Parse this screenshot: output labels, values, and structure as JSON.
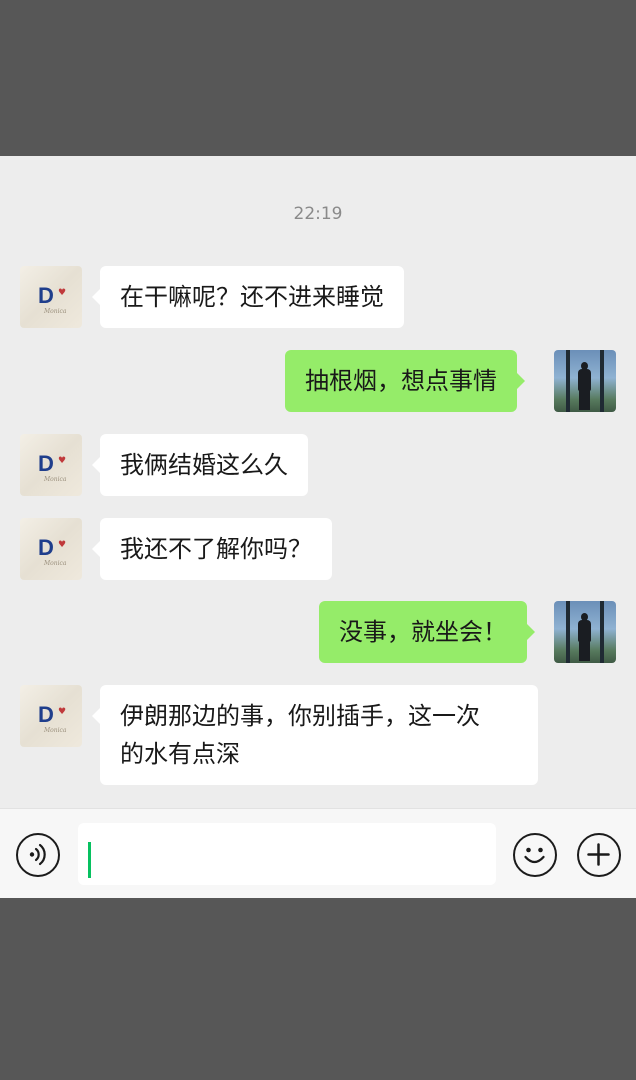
{
  "chat": {
    "timestamp": "22:19",
    "messages": [
      {
        "side": "left",
        "text": "在干嘛呢？还不进来睡觉"
      },
      {
        "side": "right",
        "text": "抽根烟，想点事情"
      },
      {
        "side": "left",
        "text": "我俩结婚这么久"
      },
      {
        "side": "left",
        "text": "我还不了解你吗？"
      },
      {
        "side": "right",
        "text": "没事，就坐会！"
      },
      {
        "side": "left",
        "text": "伊朗那边的事，你别插手，这一次\n的水有点深"
      }
    ]
  },
  "contact_avatar": {
    "logo": "D",
    "icon": "heart-icon",
    "signature": "Monica"
  },
  "self_avatar": {
    "icon": "person-silhouette-icon"
  },
  "input_bar": {
    "voice_icon": "voice-icon",
    "input_value": "",
    "emoji_icon": "emoji-icon",
    "plus_icon": "plus-icon"
  },
  "colors": {
    "chat_background": "#ededed",
    "sent_bubble": "#95ec69",
    "received_bubble": "#ffffff",
    "frame": "#575757",
    "caret": "#07c160"
  }
}
